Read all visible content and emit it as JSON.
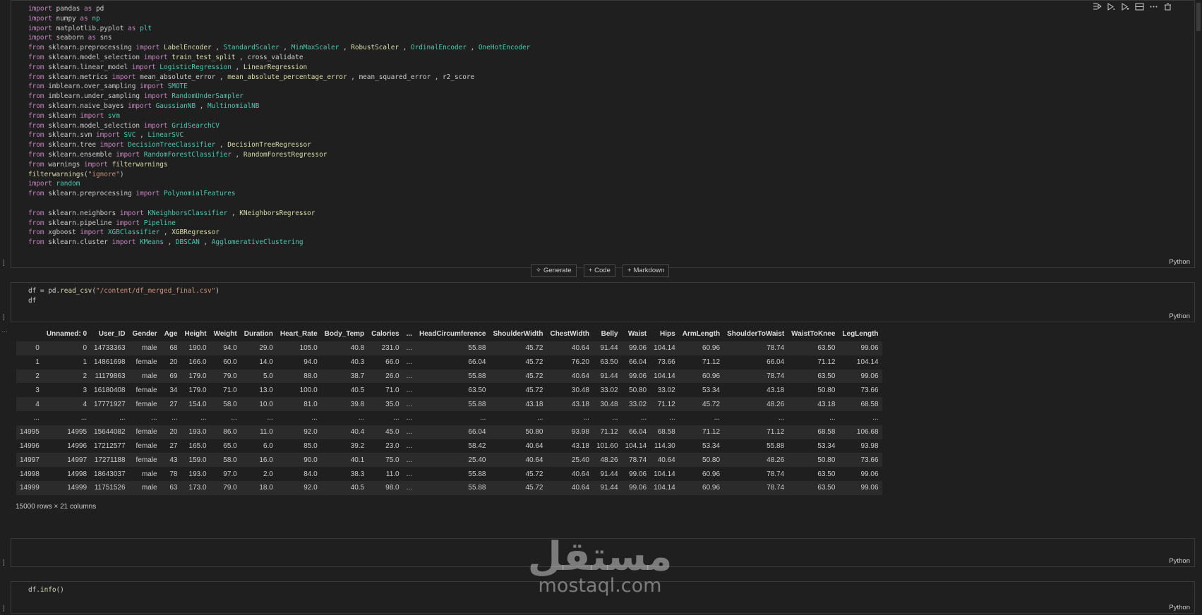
{
  "cell1": {
    "lines": [
      [
        [
          "kw",
          "import "
        ],
        [
          "mod",
          "pandas "
        ],
        [
          "kw",
          "as "
        ],
        [
          "mod",
          "pd"
        ]
      ],
      [
        [
          "kw",
          "import "
        ],
        [
          "mod",
          "numpy "
        ],
        [
          "kw",
          "as "
        ],
        [
          "cls",
          "np"
        ]
      ],
      [
        [
          "kw",
          "import "
        ],
        [
          "mod",
          "matplotlib.pyplot "
        ],
        [
          "kw",
          "as "
        ],
        [
          "cls",
          "plt"
        ]
      ],
      [
        [
          "kw",
          "import "
        ],
        [
          "mod",
          "seaborn "
        ],
        [
          "kw",
          "as "
        ],
        [
          "mod",
          "sns"
        ]
      ],
      [
        [
          "kw",
          "from "
        ],
        [
          "mod",
          "sklearn.preprocessing "
        ],
        [
          "kw",
          "import "
        ],
        [
          "fn",
          "LabelEncoder"
        ],
        [
          "plain",
          " , "
        ],
        [
          "cls",
          "StandardScaler"
        ],
        [
          "plain",
          " , "
        ],
        [
          "cls",
          "MinMaxScaler"
        ],
        [
          "plain",
          " , "
        ],
        [
          "fn",
          "RobustScaler"
        ],
        [
          "plain",
          " , "
        ],
        [
          "cls",
          "OrdinalEncoder"
        ],
        [
          "plain",
          " , "
        ],
        [
          "cls",
          "OneHotEncoder"
        ]
      ],
      [
        [
          "kw",
          "from "
        ],
        [
          "mod",
          "sklearn.model_selection "
        ],
        [
          "kw",
          "import "
        ],
        [
          "fn",
          "train_test_split"
        ],
        [
          "plain",
          " , cross_validate"
        ]
      ],
      [
        [
          "kw",
          "from "
        ],
        [
          "mod",
          "sklearn.linear_model "
        ],
        [
          "kw",
          "import "
        ],
        [
          "cls",
          "LogisticRegression"
        ],
        [
          "plain",
          " , "
        ],
        [
          "fn",
          "LinearRegression"
        ]
      ],
      [
        [
          "kw",
          "from "
        ],
        [
          "mod",
          "sklearn.metrics "
        ],
        [
          "kw",
          "import "
        ],
        [
          "plain",
          "mean_absolute_error , "
        ],
        [
          "fn",
          "mean_absolute_percentage_error"
        ],
        [
          "plain",
          " , mean_squared_error , r2_score"
        ]
      ],
      [
        [
          "kw",
          "from "
        ],
        [
          "mod",
          "imblearn.over_sampling "
        ],
        [
          "kw",
          "import "
        ],
        [
          "cls",
          "SMOTE"
        ]
      ],
      [
        [
          "kw",
          "from "
        ],
        [
          "mod",
          "imblearn.under_sampling "
        ],
        [
          "kw",
          "import "
        ],
        [
          "cls",
          "RandomUnderSampler"
        ]
      ],
      [
        [
          "kw",
          "from "
        ],
        [
          "mod",
          "sklearn.naive_bayes "
        ],
        [
          "kw",
          "import "
        ],
        [
          "cls",
          "GaussianNB"
        ],
        [
          "plain",
          " , "
        ],
        [
          "cls",
          "MultinomialNB"
        ]
      ],
      [
        [
          "kw",
          "from "
        ],
        [
          "mod",
          "sklearn "
        ],
        [
          "kw",
          "import "
        ],
        [
          "cls",
          "svm"
        ]
      ],
      [
        [
          "kw",
          "from "
        ],
        [
          "mod",
          "sklearn.model_selection "
        ],
        [
          "kw",
          "import "
        ],
        [
          "cls",
          "GridSearchCV"
        ]
      ],
      [
        [
          "kw",
          "from "
        ],
        [
          "mod",
          "sklearn.svm "
        ],
        [
          "kw",
          "import "
        ],
        [
          "cls",
          "SVC"
        ],
        [
          "plain",
          " , "
        ],
        [
          "cls",
          "LinearSVC"
        ]
      ],
      [
        [
          "kw",
          "from "
        ],
        [
          "mod",
          "sklearn.tree "
        ],
        [
          "kw",
          "import "
        ],
        [
          "cls",
          "DecisionTreeClassifier"
        ],
        [
          "plain",
          " , "
        ],
        [
          "fn",
          "DecisionTreeRegressor"
        ]
      ],
      [
        [
          "kw",
          "from "
        ],
        [
          "mod",
          "sklearn.ensemble "
        ],
        [
          "kw",
          "import "
        ],
        [
          "cls",
          "RandomForestClassifier"
        ],
        [
          "plain",
          " , "
        ],
        [
          "fn",
          "RandomForestRegressor"
        ]
      ],
      [
        [
          "kw",
          "from "
        ],
        [
          "mod",
          "warnings "
        ],
        [
          "kw",
          "import "
        ],
        [
          "fn",
          "filterwarnings"
        ]
      ],
      [
        [
          "fn",
          "filterwarnings"
        ],
        [
          "plain",
          "("
        ],
        [
          "str",
          "\"ignore\""
        ],
        [
          "plain",
          ")"
        ]
      ],
      [
        [
          "kw",
          "import "
        ],
        [
          "cls",
          "random"
        ]
      ],
      [
        [
          "kw",
          "from "
        ],
        [
          "mod",
          "sklearn.preprocessing "
        ],
        [
          "kw",
          "import "
        ],
        [
          "cls",
          "PolynomialFeatures"
        ]
      ],
      [],
      [
        [
          "kw",
          "from "
        ],
        [
          "mod",
          "sklearn.neighbors "
        ],
        [
          "kw",
          "import "
        ],
        [
          "cls",
          "KNeighborsClassifier"
        ],
        [
          "plain",
          " , "
        ],
        [
          "fn",
          "KNeighborsRegressor"
        ]
      ],
      [
        [
          "kw",
          "from "
        ],
        [
          "mod",
          "sklearn.pipeline "
        ],
        [
          "kw",
          "import "
        ],
        [
          "cls",
          "Pipeline"
        ]
      ],
      [
        [
          "kw",
          "from "
        ],
        [
          "mod",
          "xgboost "
        ],
        [
          "kw",
          "import "
        ],
        [
          "cls",
          "XGBClassifier"
        ],
        [
          "plain",
          " , "
        ],
        [
          "fn",
          "XGBRegressor"
        ]
      ],
      [
        [
          "kw",
          "from "
        ],
        [
          "mod",
          "sklearn.cluster "
        ],
        [
          "kw",
          "import "
        ],
        [
          "cls",
          "KMeans"
        ],
        [
          "plain",
          " , "
        ],
        [
          "cls",
          "DBSCAN"
        ],
        [
          "plain",
          " , "
        ],
        [
          "cls",
          "AgglomerativeClustering"
        ]
      ]
    ],
    "language": "Python"
  },
  "insert_bar": {
    "generate": "Generate",
    "code": "Code",
    "markdown": "Markdown"
  },
  "cell2": {
    "lines": [
      [
        [
          "plain",
          "df = pd."
        ],
        [
          "fn",
          "read_csv"
        ],
        [
          "plain",
          "("
        ],
        [
          "str",
          "\"/content/df_merged_final.csv\""
        ],
        [
          "plain",
          ")"
        ]
      ],
      [
        [
          "plain",
          "df"
        ]
      ]
    ],
    "language": "Python"
  },
  "dataframe": {
    "columns": [
      "Unnamed: 0",
      "User_ID",
      "Gender",
      "Age",
      "Height",
      "Weight",
      "Duration",
      "Heart_Rate",
      "Body_Temp",
      "Calories",
      "...",
      "HeadCircumference",
      "ShoulderWidth",
      "ChestWidth",
      "Belly",
      "Waist",
      "Hips",
      "ArmLength",
      "ShoulderToWaist",
      "WaistToKnee",
      "LegLength"
    ],
    "rows": [
      [
        "0",
        "0",
        "14733363",
        "male",
        "68",
        "190.0",
        "94.0",
        "29.0",
        "105.0",
        "40.8",
        "231.0",
        "...",
        "55.88",
        "45.72",
        "40.64",
        "91.44",
        "99.06",
        "104.14",
        "60.96",
        "78.74",
        "63.50",
        "99.06"
      ],
      [
        "1",
        "1",
        "14861698",
        "female",
        "20",
        "166.0",
        "60.0",
        "14.0",
        "94.0",
        "40.3",
        "66.0",
        "...",
        "66.04",
        "45.72",
        "76.20",
        "63.50",
        "66.04",
        "73.66",
        "71.12",
        "66.04",
        "71.12",
        "104.14"
      ],
      [
        "2",
        "2",
        "11179863",
        "male",
        "69",
        "179.0",
        "79.0",
        "5.0",
        "88.0",
        "38.7",
        "26.0",
        "...",
        "55.88",
        "45.72",
        "40.64",
        "91.44",
        "99.06",
        "104.14",
        "60.96",
        "78.74",
        "63.50",
        "99.06"
      ],
      [
        "3",
        "3",
        "16180408",
        "female",
        "34",
        "179.0",
        "71.0",
        "13.0",
        "100.0",
        "40.5",
        "71.0",
        "...",
        "63.50",
        "45.72",
        "30.48",
        "33.02",
        "50.80",
        "33.02",
        "53.34",
        "43.18",
        "50.80",
        "73.66"
      ],
      [
        "4",
        "4",
        "17771927",
        "female",
        "27",
        "154.0",
        "58.0",
        "10.0",
        "81.0",
        "39.8",
        "35.0",
        "...",
        "55.88",
        "43.18",
        "43.18",
        "30.48",
        "33.02",
        "71.12",
        "45.72",
        "48.26",
        "43.18",
        "68.58"
      ],
      [
        "...",
        "...",
        "...",
        "...",
        "...",
        "...",
        "...",
        "...",
        "...",
        "...",
        "...",
        "...",
        "...",
        "...",
        "...",
        "...",
        "...",
        "...",
        "...",
        "...",
        "...",
        "..."
      ],
      [
        "14995",
        "14995",
        "15644082",
        "female",
        "20",
        "193.0",
        "86.0",
        "11.0",
        "92.0",
        "40.4",
        "45.0",
        "...",
        "66.04",
        "50.80",
        "93.98",
        "71.12",
        "66.04",
        "68.58",
        "71.12",
        "71.12",
        "68.58",
        "106.68"
      ],
      [
        "14996",
        "14996",
        "17212577",
        "female",
        "27",
        "165.0",
        "65.0",
        "6.0",
        "85.0",
        "39.2",
        "23.0",
        "...",
        "58.42",
        "40.64",
        "43.18",
        "101.60",
        "104.14",
        "114.30",
        "53.34",
        "55.88",
        "53.34",
        "93.98"
      ],
      [
        "14997",
        "14997",
        "17271188",
        "female",
        "43",
        "159.0",
        "58.0",
        "16.0",
        "90.0",
        "40.1",
        "75.0",
        "...",
        "25.40",
        "40.64",
        "25.40",
        "48.26",
        "78.74",
        "40.64",
        "50.80",
        "48.26",
        "50.80",
        "73.66"
      ],
      [
        "14998",
        "14998",
        "18643037",
        "male",
        "78",
        "193.0",
        "97.0",
        "2.0",
        "84.0",
        "38.3",
        "11.0",
        "...",
        "55.88",
        "45.72",
        "40.64",
        "91.44",
        "99.06",
        "104.14",
        "60.96",
        "78.74",
        "63.50",
        "99.06"
      ],
      [
        "14999",
        "14999",
        "11751526",
        "male",
        "63",
        "173.0",
        "79.0",
        "18.0",
        "92.0",
        "40.5",
        "98.0",
        "...",
        "55.88",
        "45.72",
        "40.64",
        "91.44",
        "99.06",
        "104.14",
        "60.96",
        "78.74",
        "63.50",
        "99.06"
      ]
    ],
    "shape_text": "15000 rows × 21 columns"
  },
  "cell3": {
    "language": "Python"
  },
  "cell4": {
    "lines": [
      [
        [
          "plain",
          "df."
        ],
        [
          "fn",
          "info"
        ],
        [
          "plain",
          "()"
        ]
      ]
    ],
    "language": "Python"
  },
  "watermark": {
    "arabic": "مستقل",
    "latin": "mostaql.com"
  }
}
